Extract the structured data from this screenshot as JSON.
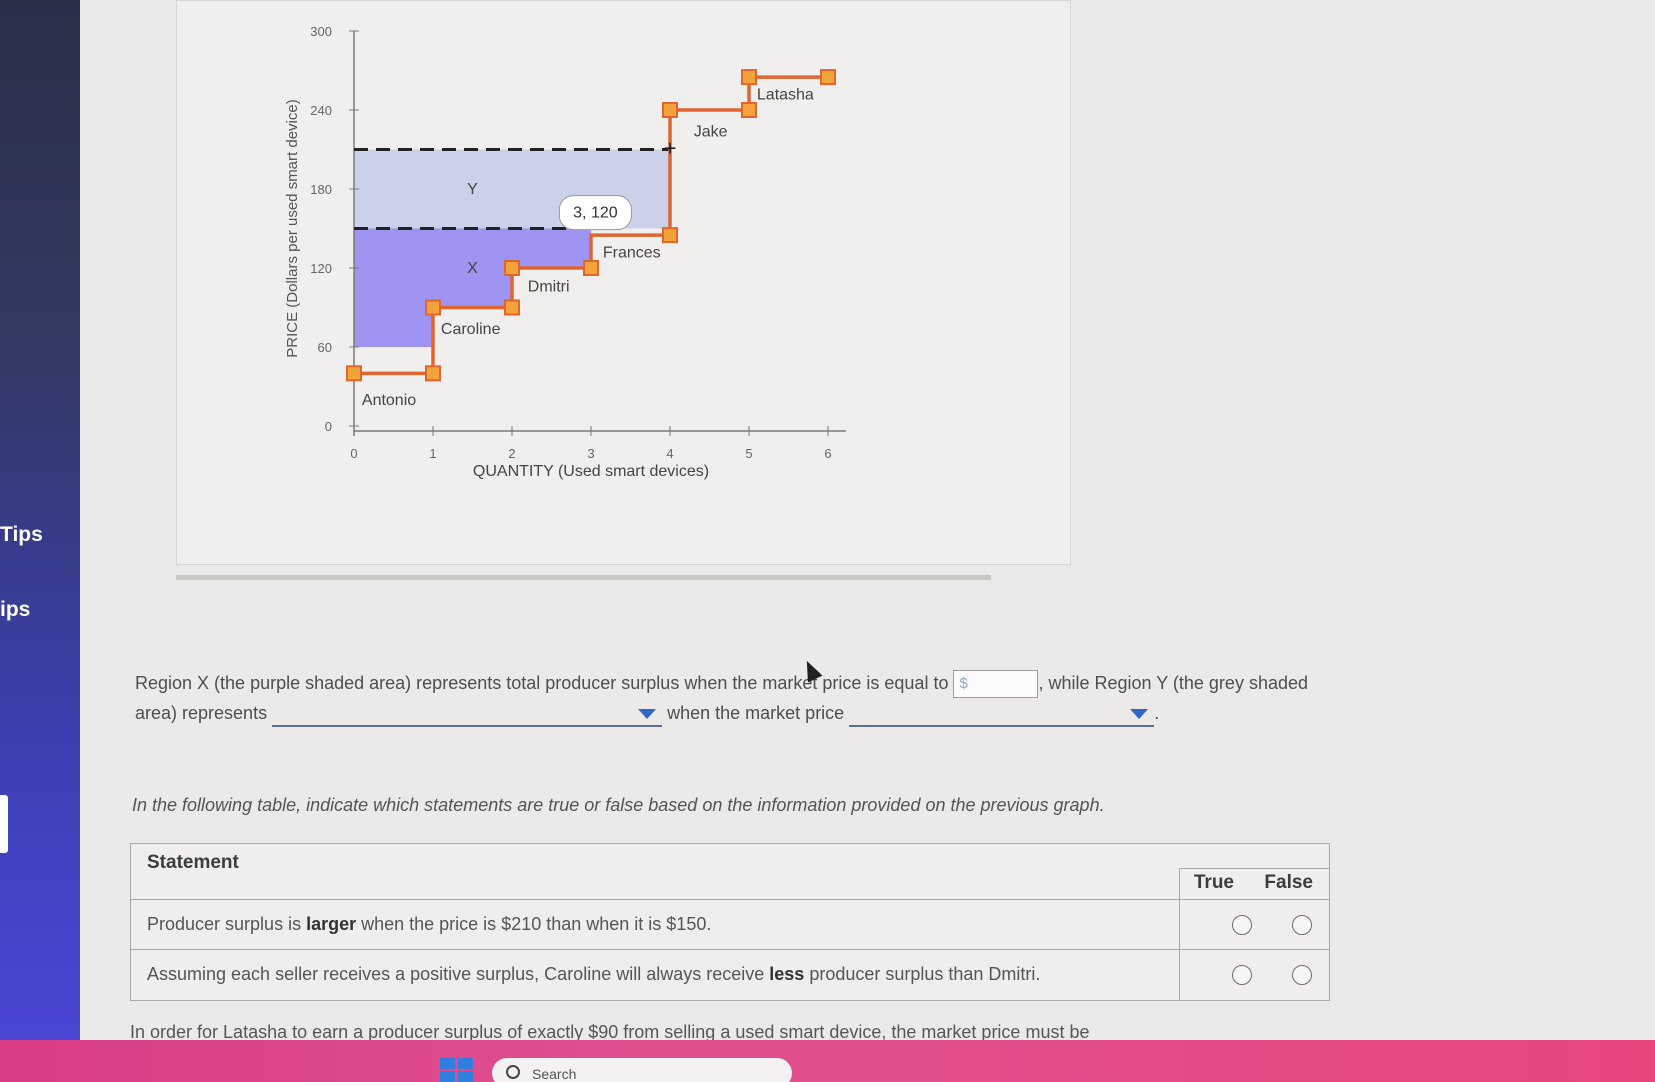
{
  "sidebar": {
    "tips_label_1": "Tips",
    "tips_label_2": "ips"
  },
  "chart_data": {
    "type": "step",
    "xlabel": "QUANTITY (Used smart devices)",
    "ylabel": "PRICE (Dollars per used smart device)",
    "x_ticks": [
      "0",
      "1",
      "2",
      "3",
      "4",
      "5",
      "6"
    ],
    "y_ticks": [
      "0",
      "60",
      "120",
      "180",
      "240",
      "300"
    ],
    "xlim": [
      0,
      6
    ],
    "ylim": [
      0,
      300
    ],
    "supply_points": [
      [
        0,
        30
      ],
      [
        1,
        30
      ],
      [
        1,
        60
      ],
      [
        2,
        60
      ],
      [
        2,
        90
      ],
      [
        3,
        90
      ],
      [
        4,
        150
      ],
      [
        4,
        210
      ],
      [
        5,
        210
      ],
      [
        5,
        240
      ],
      [
        6,
        240
      ]
    ],
    "sellers": [
      {
        "name": "Antonio",
        "x": 0.5,
        "y": 30
      },
      {
        "name": "Caroline",
        "x": 1.5,
        "y": 60
      },
      {
        "name": "Dmitri",
        "x": 2.5,
        "y": 90
      },
      {
        "name": "Frances",
        "x": 3.5,
        "y": 120
      },
      {
        "name": "Jake",
        "x": 4.5,
        "y": 210
      },
      {
        "name": "Latasha",
        "x": 5.5,
        "y": 240
      }
    ],
    "region_x_label": "X",
    "region_y_label": "Y",
    "price_line_1": 150,
    "price_line_2": 210,
    "tooltip": "3, 120",
    "colors": {
      "region_x": "#9b8ef3",
      "region_y": "#c6cde8",
      "supply": "#e0652e",
      "dashed": "#222222"
    }
  },
  "question": {
    "part1": "Region X (the purple shaded area) represents total producer surplus when the market price is equal to",
    "dollar_placeholder": "$",
    "part2": ", while Region Y (the grey shaded",
    "part3": "area) represents",
    "part4": "when the market price",
    "part5": "."
  },
  "instructions": "In the following table, indicate which statements are true or false based on the information provided on the previous graph.",
  "table": {
    "header_statement": "Statement",
    "header_true": "True",
    "header_false": "False",
    "rows": [
      {
        "pre": "Producer surplus is ",
        "bold": "larger",
        "post": " when the price is $210 than when it is $150."
      },
      {
        "pre": "Assuming each seller receives a positive surplus, Caroline will always receive ",
        "bold": "less",
        "post": " producer surplus than Dmitri."
      }
    ]
  },
  "cutoff_text": "In order for Latasha to earn a producer surplus of exactly $90 from selling a used smart device, the market price must be",
  "taskbar": {
    "search_label": "Search"
  }
}
